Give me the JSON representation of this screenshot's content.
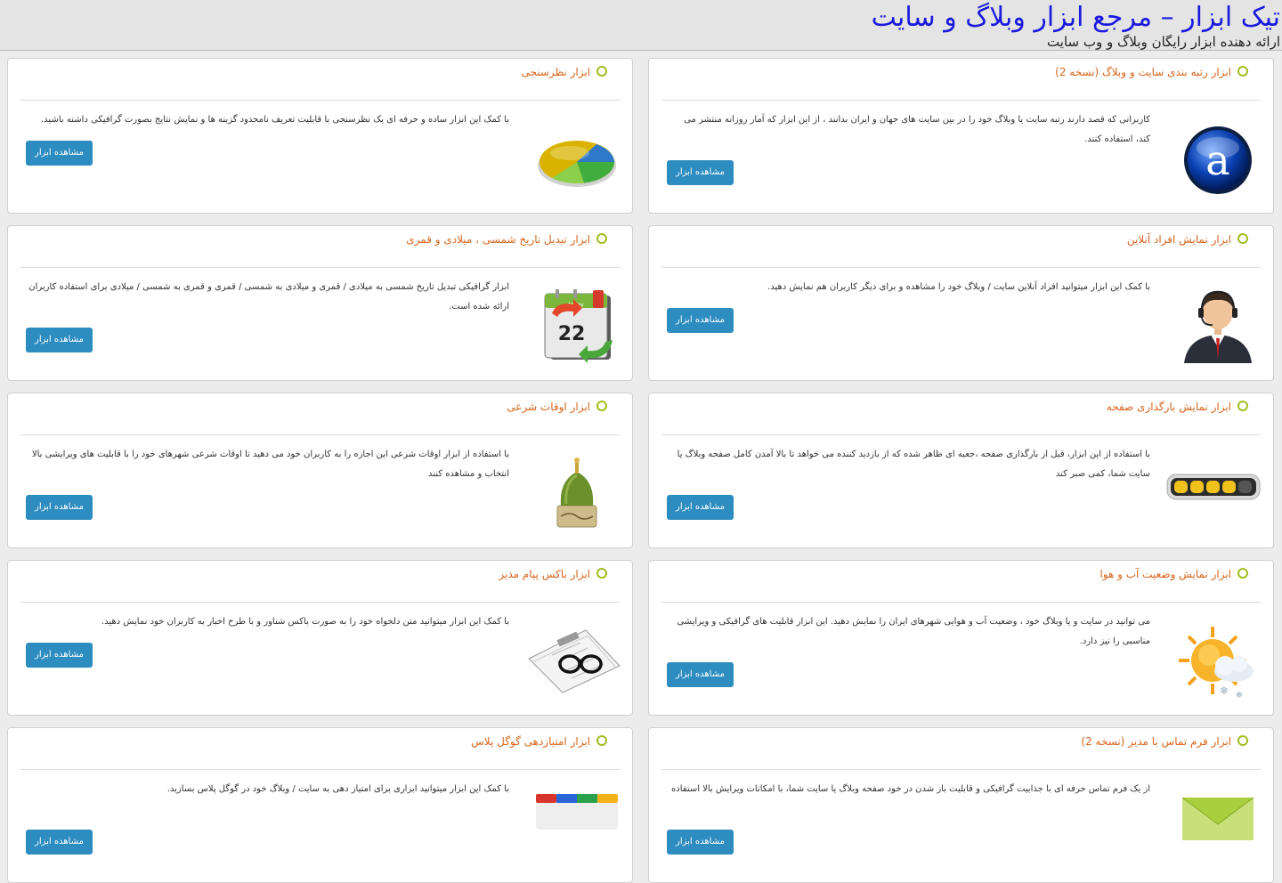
{
  "header": {
    "title": "تیک ابزار – مرجع ابزار وبلاگ و سایت",
    "subtitle": "ارائه دهنده ابزار رایگان وبلاگ و وب سایت"
  },
  "cards": [
    {
      "title": "ابزار رتبه بندی سایت و وبلاگ (نسخه 2)",
      "desc": "کاربرانی که قصد دارند رتبه سایت یا وبلاگ خود را در بین سایت های جهان و ایران بدانند ، از این ابزار که آمار روزانه منتشر می کند، استفاده کنند.",
      "button": "مشاهده ابزار",
      "icon": "alexa-logo-icon"
    },
    {
      "title": "ابزار نظرسنجی",
      "desc": "با کمک این ابزار ساده و حرفه ای یک نظرسنجی با قابلیت تعریف نامحدود گزینه ها و نمایش نتایج بصورت گرافیکی داشته باشید.",
      "button": "مشاهده ابزار",
      "icon": "pie-chart-icon"
    },
    {
      "title": "ابزار نمایش افراد آنلاین",
      "desc": "با کمک این ابزار میتوانید افراد آنلاین سایت / وبلاگ خود را مشاهده و برای دیگر کاربران هم نمایش دهید.",
      "button": "مشاهده ابزار",
      "icon": "support-agent-icon"
    },
    {
      "title": "ابزار تبدیل تاریخ شمسی ، میلادی و قمری",
      "desc": "ابزار گرافیکی تبدیل تاریخ شمسی به میلادی / قمری و میلادی به شمسی / قمری و قمری به شمسی / میلادی برای استفاده کاربران ارائه شده است.",
      "button": "مشاهده ابزار",
      "icon": "calendar-convert-icon",
      "calendar_day": "22",
      "calendar_header": "today"
    },
    {
      "title": "ابزار نمایش بارگذاری صفحه",
      "desc": "با استفاده از این ابزار، قبل از بارگذاری صفحه ،جعبه ای ظاهر شده که از بازدید کننده می خواهد تا بالا آمدن کامل صفحه وبلاگ یا سایت شما، کمی صبر کند",
      "button": "مشاهده ابزار",
      "icon": "loading-bar-icon"
    },
    {
      "title": "ابزار اوقات شرعی",
      "desc": "با استفاده از ابزار اوقات شرعی این اجازه را به کاربران خود می دهید تا اوقات شرعی شهرهای خود را با قابلیت های ویرایشی بالا انتخاب و مشاهده کنند",
      "button": "مشاهده ابزار",
      "icon": "mosque-dome-icon"
    },
    {
      "title": "ابزار نمایش وضعیت آب و هوا",
      "desc": "می توانید در سایت و یا وبلاگ خود ، وضعیت آب و هوایی شهرهای ایران را نمایش دهید. این ابزار قابلیت های گرافیکی و ویرایشی مناسبی را نیز دارد.",
      "button": "مشاهده ابزار",
      "icon": "weather-sun-cloud-icon"
    },
    {
      "title": "ابزار باکس پیام مدیر",
      "desc": "با کمک این ابزار میتوانید متن دلخواه خود را به صورت باکس شناور و با طرح اخبار به کاربران خود نمایش دهید.",
      "button": "مشاهده ابزار",
      "icon": "newspaper-glasses-icon"
    },
    {
      "title": "ابزار فرم تماس با مدیر (نسخه 2)",
      "desc": "از یک فرم تماس حرفه ای با جذابیت گرافیکی و قابلیت باز شدن در خود صفحه وبلاگ یا سایت شما، با امکانات ویرایش بالا استفاده",
      "button": "مشاهده ابزار",
      "icon": "envelope-icon"
    },
    {
      "title": "ابزار امتیازدهی گوگل پلاس",
      "desc": "با کمک این ابزار میتوانید ابزاری برای امتیاز دهی به سایت / وبلاگ خود در گوگل پلاس بسازید.",
      "button": "مشاهده ابزار",
      "icon": "google-plus-icon"
    }
  ],
  "colors": {
    "title": "#d7651b",
    "button": "#2d8cc0",
    "header_title": "#1a1adf",
    "bullet": "#9fbf1f"
  }
}
